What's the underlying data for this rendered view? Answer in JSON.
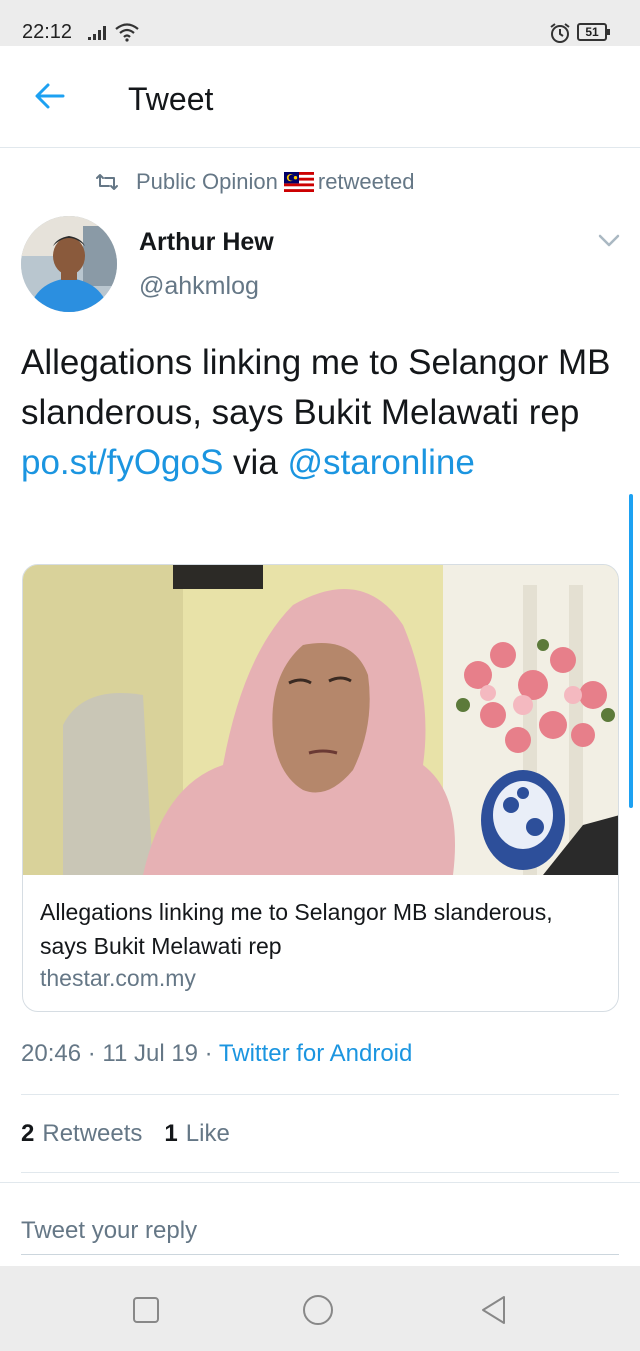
{
  "status_bar": {
    "time": "22:12",
    "battery": "51",
    "icons": [
      "signal-icon",
      "wifi-icon",
      "alarm-icon",
      "battery-icon"
    ]
  },
  "app_bar": {
    "title": "Tweet",
    "back_icon": "arrow-left-icon"
  },
  "retweet": {
    "icon": "retweet-icon",
    "retweeter": "Public Opinion",
    "flag": "malaysia-flag-icon",
    "action": "retweeted"
  },
  "author": {
    "name": "Arthur Hew",
    "handle": "@ahkmlog"
  },
  "tweet": {
    "text_part1": "Allegations linking me to Selangor MB slanderous, says Bukit Melawati rep ",
    "link": "po.st/fyOgoS",
    "text_part2": " via ",
    "mention": "@staronline"
  },
  "card": {
    "title": "Allegations linking me to Selangor MB slanderous, says Bukit Melawati rep",
    "domain": "thestar.com.my"
  },
  "meta": {
    "time": "20:46",
    "separator": " · ",
    "date": "11 Jul 19",
    "source": "Twitter for Android"
  },
  "stats": {
    "retweets_count": "2",
    "retweets_label": "Retweets",
    "likes_count": "1",
    "likes_label": "Like"
  },
  "reply": {
    "placeholder": "Tweet your reply"
  },
  "colors": {
    "accent": "#1b95e0",
    "secondary_text": "#657786",
    "primary_text": "#14171a"
  }
}
